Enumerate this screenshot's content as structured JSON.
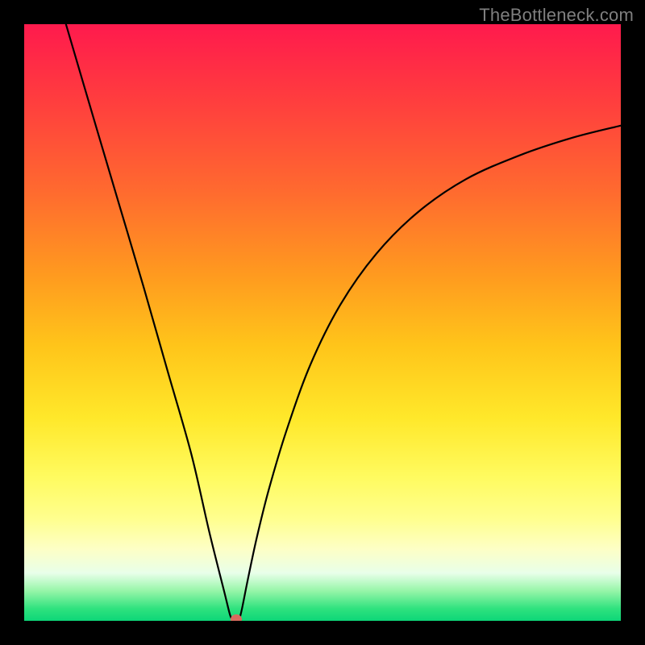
{
  "watermark": "TheBottleneck.com",
  "colors": {
    "curve": "#000000",
    "marker": "#d86b5e",
    "frame": "#000000"
  },
  "chart_data": {
    "type": "line",
    "title": "",
    "xlabel": "",
    "ylabel": "",
    "xlim": [
      0,
      100
    ],
    "ylim": [
      0,
      100
    ],
    "grid": false,
    "series": [
      {
        "name": "left-branch",
        "x": [
          7,
          12,
          16,
          20,
          24,
          28,
          31,
          33.5,
          34.5,
          35
        ],
        "y": [
          100,
          83,
          69.5,
          56,
          42,
          28,
          15,
          5,
          1,
          0
        ]
      },
      {
        "name": "right-branch",
        "x": [
          36,
          36.5,
          37.5,
          39,
          41,
          44,
          48,
          53,
          59,
          66,
          74,
          83,
          92,
          100
        ],
        "y": [
          0,
          2,
          7,
          14,
          22,
          32,
          43,
          53,
          61.5,
          68.5,
          74,
          78,
          81,
          83
        ]
      }
    ],
    "flat_segment": {
      "x0": 35,
      "x1": 36,
      "y": 0
    },
    "marker": {
      "x": 35.5,
      "y": 0
    },
    "legend": null
  }
}
